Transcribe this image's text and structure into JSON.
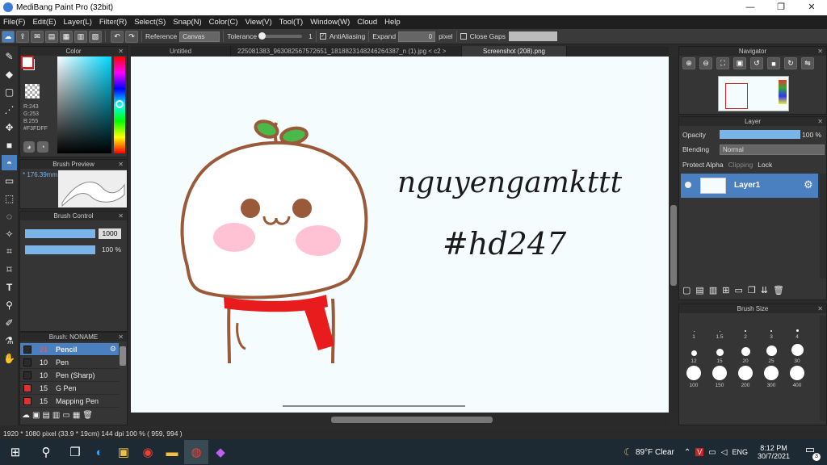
{
  "window": {
    "title": "MediBang Paint Pro (32bit)",
    "minimize": "—",
    "maximize": "❐",
    "close": "✕"
  },
  "menu": [
    "File(F)",
    "Edit(E)",
    "Layer(L)",
    "Filter(R)",
    "Select(S)",
    "Snap(N)",
    "Color(C)",
    "View(V)",
    "Tool(T)",
    "Window(W)",
    "Cloud",
    "Help"
  ],
  "toolbar": {
    "reference_label": "Reference",
    "reference_value": "Canvas",
    "tolerance_label": "Tolerance",
    "tolerance_value": "1",
    "antialias_label": "AntiAliasing",
    "expand_label": "Expand",
    "expand_value": "0",
    "expand_unit": "pixel",
    "close_gaps_label": "Close Gaps"
  },
  "tabs": [
    {
      "label": "Untitled"
    },
    {
      "label": "225081383_963082567572651_1818823148246264387_n (1).jpg < c2 >"
    },
    {
      "label": "Screenshot (208).png"
    }
  ],
  "color_panel": {
    "title": "Color",
    "r": "R:243",
    "g": "G:253",
    "b": "B:255",
    "hex": "#F3FDFF",
    "primary": "#F3FDFF",
    "secondary": "#d02020"
  },
  "brush_preview": {
    "title": "Brush Preview",
    "size": "* 176.39mm"
  },
  "brush_control": {
    "title": "Brush Control",
    "size_value": "1000",
    "opacity_value": "100 %"
  },
  "brush_list": {
    "title": "Brush: NONAME",
    "items": [
      {
        "size": "21",
        "name": "Pencil",
        "color": "#2b2b2b",
        "active": true
      },
      {
        "size": "10",
        "name": "Pen",
        "color": "#2b2b2b",
        "active": false
      },
      {
        "size": "10",
        "name": "Pen (Sharp)",
        "color": "#2b2b2b",
        "active": false
      },
      {
        "size": "15",
        "name": "G Pen",
        "color": "#e03030",
        "active": false
      },
      {
        "size": "15",
        "name": "Mapping Pen",
        "color": "#e03030",
        "active": false
      }
    ]
  },
  "canvas_text": {
    "line1": "nguyengamkttt",
    "line2": "#hd247"
  },
  "navigator": {
    "title": "Navigator"
  },
  "layer_panel": {
    "title": "Layer",
    "opacity_label": "Opacity",
    "opacity_value": "100 %",
    "opacity": 1.0,
    "blending_label": "Blending",
    "blending_value": "Normal",
    "protect_alpha": "Protect Alpha",
    "clipping": "Clipping",
    "lock": "Lock",
    "layer_name": "Layer1"
  },
  "brush_size": {
    "title": "Brush Size",
    "sizes": [
      "1",
      "1.5",
      "2",
      "3",
      "4",
      "12",
      "15",
      "20",
      "25",
      "30",
      "100",
      "150",
      "200",
      "300",
      "400"
    ]
  },
  "status": {
    "text": "1920 * 1080 pixel  (33.9 * 19cm)  144 dpi  100 %  ( 959, 994 )"
  },
  "taskbar": {
    "weather": "89°F  Clear",
    "lang": "ENG",
    "time": "8:12 PM",
    "date": "30/7/2021",
    "notif_count": "3"
  }
}
